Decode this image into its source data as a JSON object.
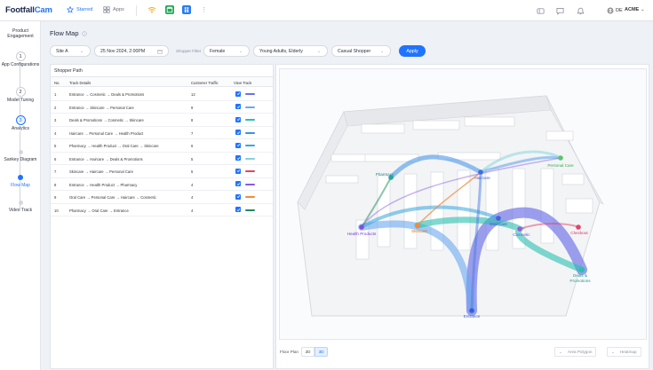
{
  "brand": {
    "part1": "Footfall",
    "part2": "Cam"
  },
  "topnav": {
    "starred": "Starred",
    "apps": "Apps"
  },
  "topright": {
    "lang": "DE",
    "org": "ACME"
  },
  "sidebar": {
    "title": "Product Engagement",
    "steps": [
      {
        "num": "1",
        "label": "App Configurations"
      },
      {
        "num": "2",
        "label": "Model Tuning"
      },
      {
        "num": "3",
        "label": "Analytics"
      }
    ],
    "substeps": [
      {
        "label": "Sankey Diagram"
      },
      {
        "label": "Flow Map"
      },
      {
        "label": "Video Track"
      }
    ]
  },
  "page": {
    "title": "Flow Map"
  },
  "filters": {
    "site": "Site A",
    "datetime": "25 Nov 2024, 2:00PM",
    "shopper_filter_label": "Shopper Filter",
    "gender": "Female",
    "age": "Young Adults, Elderly",
    "type": "Casual Shopper",
    "apply": "Apply"
  },
  "table": {
    "title": "Shopper Path",
    "headers": {
      "no": "No.",
      "details": "Track Details",
      "traffic": "Customer Traffic",
      "view": "View Track"
    },
    "rows": [
      {
        "no": "1",
        "details": "Entrance → Cosmetic → Deals & Promotions",
        "traffic": "12",
        "color": "#6a6fe6"
      },
      {
        "no": "2",
        "details": "Entrance → Skincare → Personal Care",
        "traffic": "9",
        "color": "#6aa8f0"
      },
      {
        "no": "3",
        "details": "Deals & Promotions → Cosmetic → Skincare",
        "traffic": "8",
        "color": "#2bbfb0"
      },
      {
        "no": "4",
        "details": "Haircare → Personal Care → Health Product",
        "traffic": "7",
        "color": "#3a8fe8"
      },
      {
        "no": "5",
        "details": "Pharmacy → Health Product → Oral Care → Skincare",
        "traffic": "6",
        "color": "#35a6e0"
      },
      {
        "no": "6",
        "details": "Entrance → Haircare → Deals & Promotions",
        "traffic": "5",
        "color": "#7fd4dc"
      },
      {
        "no": "7",
        "details": "Skincare → Haircare → Personal Care",
        "traffic": "5",
        "color": "#e0446a"
      },
      {
        "no": "8",
        "details": "Entrance → Health Product → Pharmacy",
        "traffic": "4",
        "color": "#8a5ae0"
      },
      {
        "no": "9",
        "details": "Oral Care → Personal Care → Haircare → Cosmetic",
        "traffic": "4",
        "color": "#f08a3c"
      },
      {
        "no": "10",
        "details": "Pharmacy → Oral Care → Entrance",
        "traffic": "4",
        "color": "#1f8a5a"
      }
    ]
  },
  "map": {
    "labels": {
      "pharmacy": "Pharmacy",
      "personal_care": "Personal Care",
      "haircare": "Haircare",
      "health_products": "Health Products",
      "skincare": "Skincare",
      "cosmetic": "Cosmetic",
      "oral_care": "Oral Care",
      "checkout": "Checkout",
      "deals": "Deals & Promotions",
      "entrance": "Entrance"
    },
    "footer": {
      "floor_plan": "Floor Plan",
      "seg_2d": "2D",
      "seg_3d": "3D",
      "area_polygon": "Area Polygon",
      "heatmap": "Heatmap"
    }
  }
}
